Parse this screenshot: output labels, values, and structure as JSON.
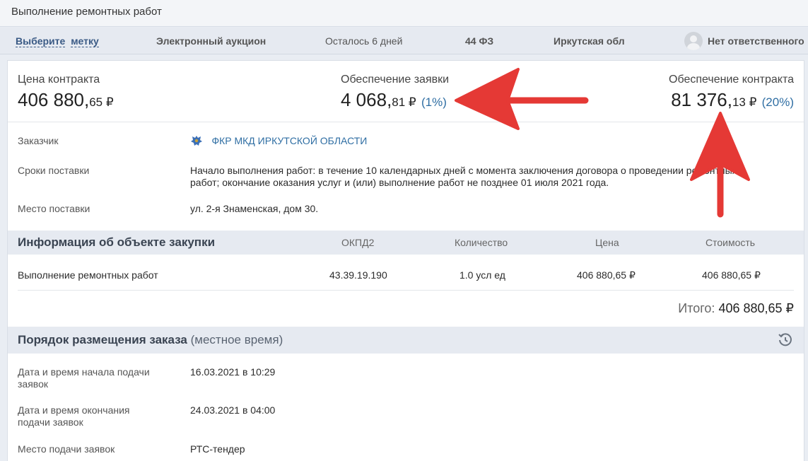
{
  "title": "Выполнение ремонтных работ",
  "meta": {
    "mark_a": "Выберите",
    "mark_b": "метку",
    "procedure": "Электронный аукцион",
    "remaining": "Осталось 6 дней",
    "law": "44 ФЗ",
    "region": "Иркутская обл",
    "responsible": "Нет ответственного"
  },
  "prices": {
    "contract": {
      "label": "Цена контракта",
      "main": "406 880,",
      "kop": "65 ₽",
      "pct": ""
    },
    "application": {
      "label": "Обеспечение заявки",
      "main": "4 068,",
      "kop": "81 ₽",
      "pct": "(1%)"
    },
    "security": {
      "label": "Обеспечение контракта",
      "main": "81 376,",
      "kop": "13 ₽",
      "pct": "(20%)"
    }
  },
  "details": {
    "customer_label": "Заказчик",
    "customer_value": "ФКР МКД ИРКУТСКОЙ ОБЛАСТИ",
    "terms_label": "Сроки поставки",
    "terms_line1": "Начало выполнения работ: в течение 10 календарных дней с момента заключения договора о проведении ремонтных",
    "terms_line2": "работ; окончание оказания услуг и (или) выполнение работ не позднее 01 июля 2021 года.",
    "place_label": "Место поставки",
    "place_value": "ул. 2-я Знаменская, дом 30."
  },
  "items": {
    "section_title": "Информация об объекте закупки",
    "columns": [
      "ОКПД2",
      "Количество",
      "Цена",
      "Стоимость"
    ],
    "row": {
      "name": "Выполнение ремонтных работ",
      "okpd": "43.39.19.190",
      "qty": "1.0 усл ед",
      "price": "406 880,65 ₽",
      "cost": "406 880,65 ₽"
    },
    "total_label": "Итого:",
    "total_value": "406 880,65 ₽"
  },
  "order": {
    "section_title": "Порядок размещения заказа",
    "section_suffix": "(местное время)",
    "start_label_1": "Дата и время начала подачи",
    "start_label_2": "заявок",
    "start_value": "16.03.2021 в 10:29",
    "end_label_1": "Дата и время окончания",
    "end_label_2": "подачи заявок",
    "end_value": "24.03.2021 в 04:00",
    "place_label": "Место подачи заявок",
    "place_value": "РТС-тендер"
  },
  "colors": {
    "arrow": "#e53935",
    "link": "#2f6ea3",
    "section_bg": "#e6eaf1"
  },
  "icons": [
    "avatar-icon",
    "coat-of-arms-icon",
    "history-icon"
  ]
}
